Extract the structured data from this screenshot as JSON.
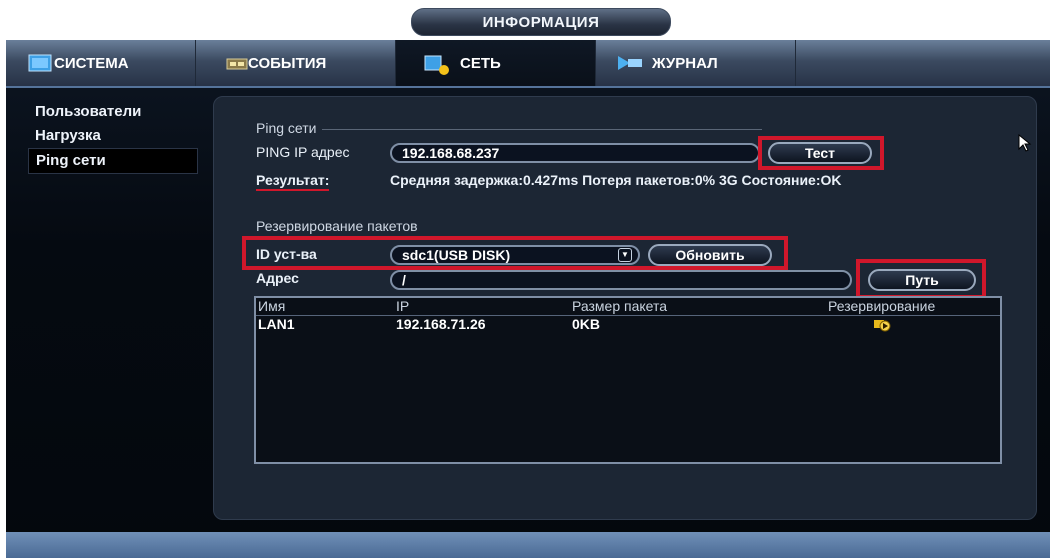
{
  "title": "ИНФОРМАЦИЯ",
  "tabs": [
    {
      "label": "СИСТЕМА",
      "icon": "monitor-icon"
    },
    {
      "label": "СОБЫТИЯ",
      "icon": "event-icon"
    },
    {
      "label": "СЕТЬ",
      "icon": "network-icon"
    },
    {
      "label": "ЖУРНАЛ",
      "icon": "log-icon"
    }
  ],
  "sidebar": {
    "items": [
      {
        "label": "Пользователи"
      },
      {
        "label": "Нагрузка"
      },
      {
        "label": "Ping сети"
      }
    ]
  },
  "ping": {
    "section_title": "Ping сети",
    "ip_label": "PING IP адрес",
    "ip_value": "192.168.68.237",
    "test_button": "Тест",
    "result_label": "Результат:",
    "result_text": "Средняя задержка:0.427ms  Потеря пакетов:0%  3G Состояние:OK"
  },
  "backup": {
    "section_title": "Резервирование пакетов",
    "device_label": "ID уст-ва",
    "device_value": "sdc1(USB DISK)",
    "refresh_button": "Обновить",
    "path_label": "Адрес",
    "path_value": "/",
    "path_button": "Путь",
    "table": {
      "headers": [
        "Имя",
        "IP",
        "Размер пакета",
        "Резервирование"
      ],
      "rows": [
        {
          "name": "LAN1",
          "ip": "192.168.71.26",
          "size": "0KB",
          "backup_icon": "backup-play-icon"
        }
      ]
    }
  },
  "colors": {
    "highlight": "#d0172b",
    "panel": "#1c2634",
    "tab_bar": "#3b4a60"
  }
}
